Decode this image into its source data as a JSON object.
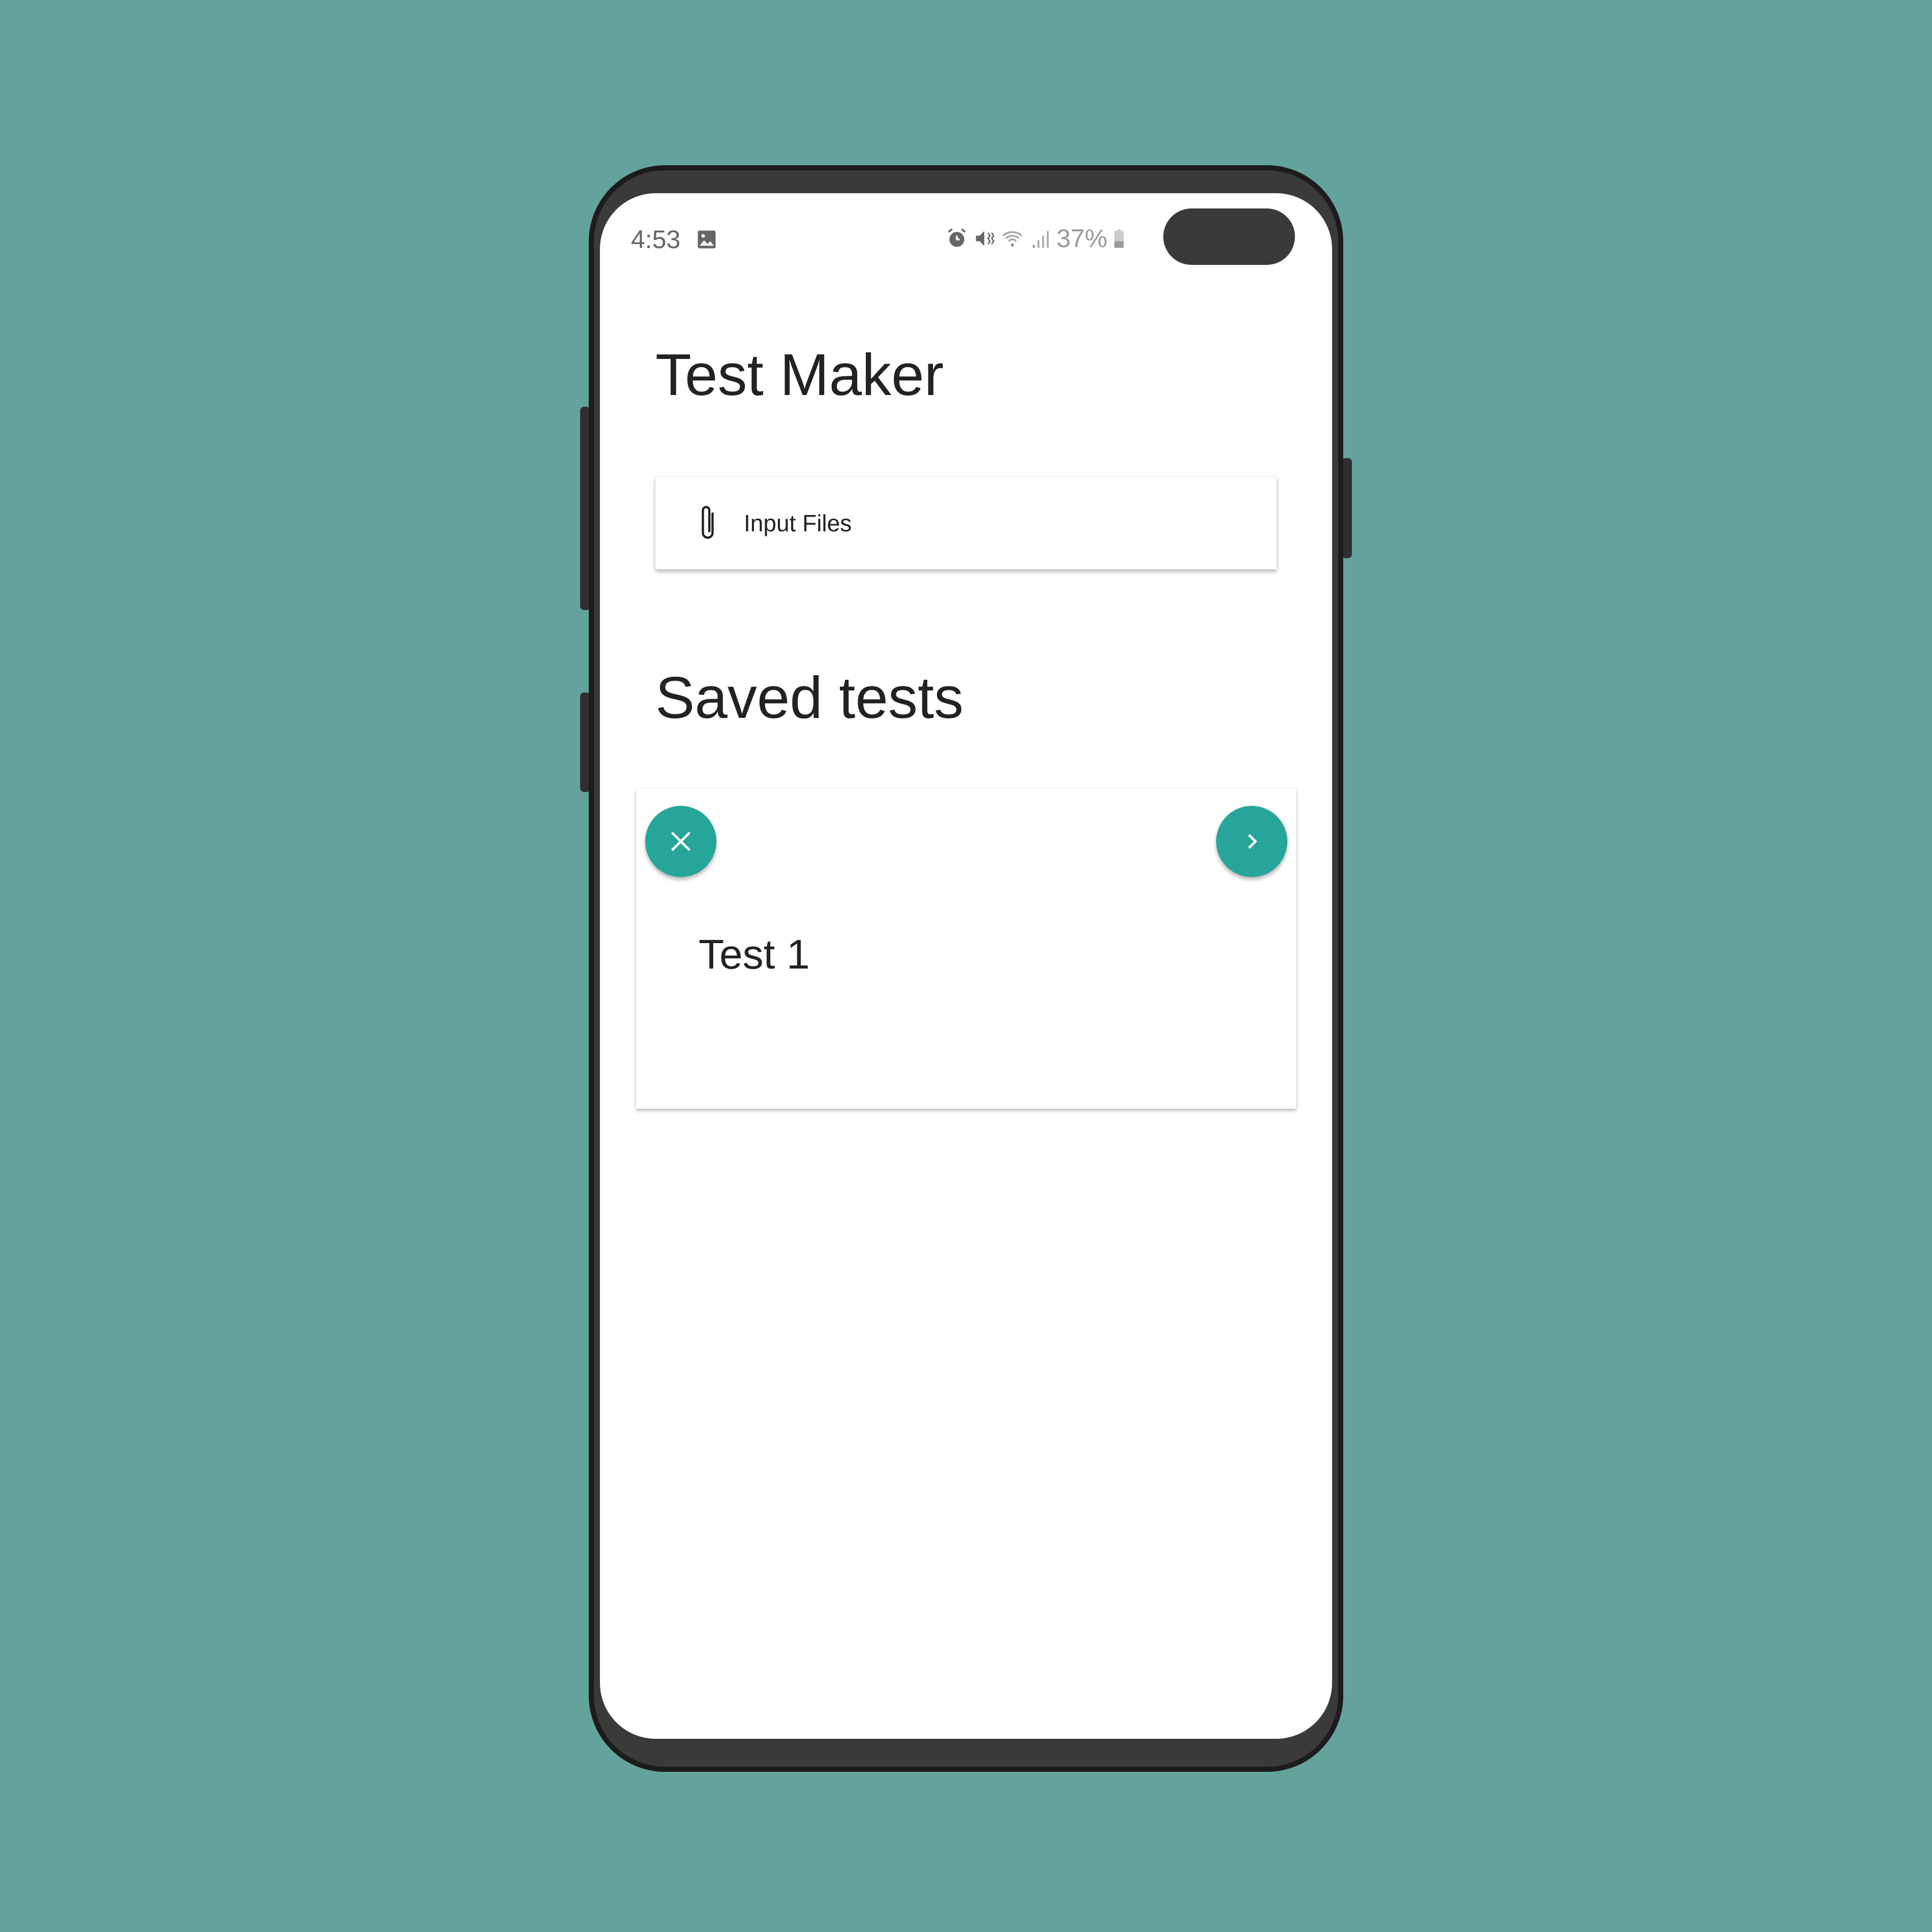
{
  "status_bar": {
    "time": "4:53",
    "battery": "37%"
  },
  "app": {
    "title": "Test Maker"
  },
  "input_files": {
    "label": "Input Files"
  },
  "saved_tests": {
    "heading": "Saved tests",
    "items": [
      {
        "name": "Test 1"
      }
    ]
  },
  "colors": {
    "accent": "#26a69a",
    "background": "#64a39c"
  }
}
